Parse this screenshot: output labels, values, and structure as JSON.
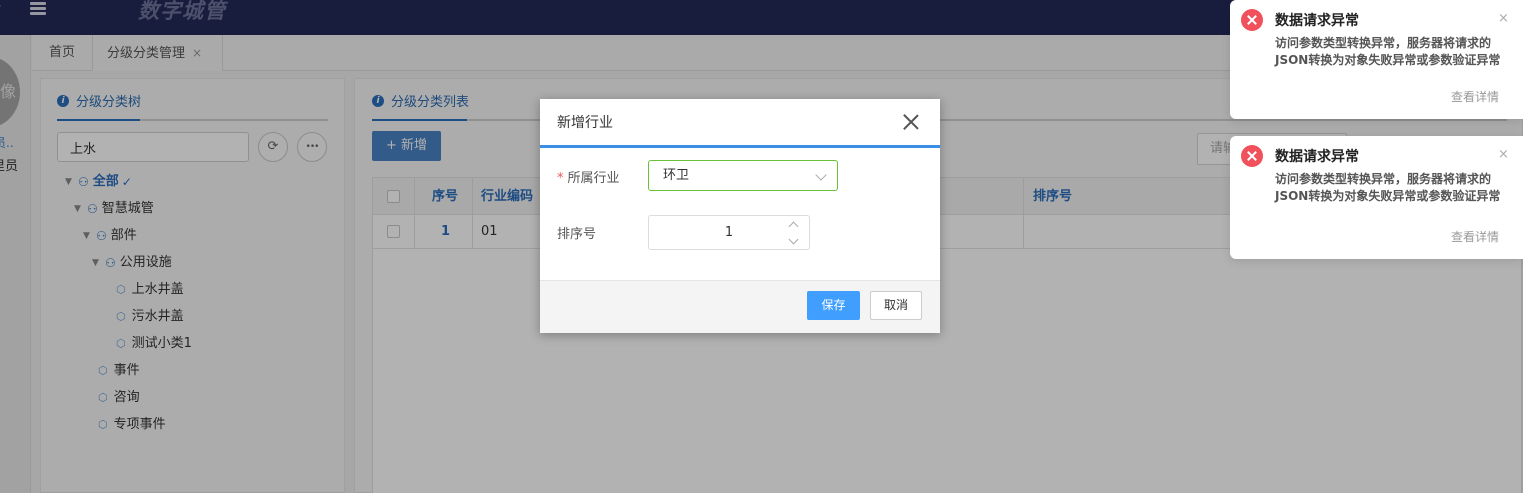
{
  "app": {
    "title": "数字城管",
    "left_glyph": "›"
  },
  "sidebar": {
    "avatar_text": "像",
    "user_name": "员..",
    "user_role": "里员"
  },
  "tabs": [
    {
      "label": "首页"
    },
    {
      "label": "分级分类管理",
      "close": "×"
    }
  ],
  "tree_panel": {
    "title": "分级分类树",
    "search_value": "上水",
    "refresh_icon": "⟳",
    "more_icon": "•••",
    "nodes": [
      {
        "label": "全部",
        "checked": "✓"
      },
      {
        "label": "智慧城管"
      },
      {
        "label": "部件"
      },
      {
        "label": "公用设施"
      },
      {
        "label": "上水井盖"
      },
      {
        "label": "污水井盖"
      },
      {
        "label": "测试小类1"
      },
      {
        "label": "事件"
      },
      {
        "label": "咨询"
      },
      {
        "label": "专项事件"
      }
    ]
  },
  "list_panel": {
    "title": "分级分类列表",
    "add_label": "+ 新增",
    "search_placeholder": "请输",
    "columns": [
      "序号",
      "行业编码",
      "排序号"
    ],
    "rows": [
      {
        "seq": "1",
        "code": "01"
      }
    ]
  },
  "modal": {
    "title": "新增行业",
    "industry_label": "所属行业",
    "required_mark": "*",
    "industry_value": "环卫",
    "sort_label": "排序号",
    "sort_value": "1",
    "save_label": "保存",
    "cancel_label": "取消"
  },
  "notifications": [
    {
      "title": "数据请求异常",
      "message": "访问参数类型转换异常，服务器将请求的JSON转换为对象失败异常或参数验证异常",
      "link": "查看详情",
      "close": "×"
    },
    {
      "title": "数据请求异常",
      "message": "访问参数类型转换异常，服务器将请求的JSON转换为对象失败异常或参数验证异常",
      "link": "查看详情",
      "close": "×"
    }
  ],
  "colors": {
    "topbar": "#232a58",
    "accent": "#2c6fbd",
    "primary_button": "#409eff",
    "error": "#f0515a",
    "valid_border": "#67c23a"
  }
}
